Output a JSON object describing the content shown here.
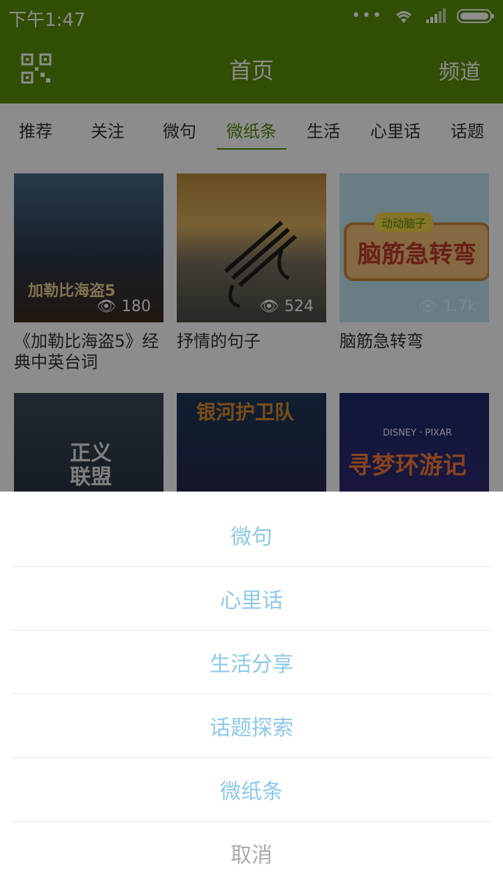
{
  "status": {
    "time": "下午1:47"
  },
  "header": {
    "title": "首页",
    "channel_label": "频道"
  },
  "tabs": [
    {
      "label": "推荐"
    },
    {
      "label": "关注"
    },
    {
      "label": "微句"
    },
    {
      "label": "微纸条",
      "active": true
    },
    {
      "label": "生活"
    },
    {
      "label": "心里话"
    },
    {
      "label": "话题"
    }
  ],
  "cards": [
    {
      "title": "《加勒比海盗5》经典中英台词",
      "views": "180",
      "poster_text": "加勒比海盗5"
    },
    {
      "title": "抒情的句子",
      "views": "524"
    },
    {
      "title": "脑筋急转弯",
      "views": "1.7k",
      "poster_text": "脑筋急转弯",
      "poster_badge": "动动脑子"
    },
    {
      "poster_text": "正义联盟"
    },
    {
      "poster_text": "银河护卫队"
    },
    {
      "poster_text": "寻梦环游记",
      "poster_badge": "DISNEY · PIXAR"
    }
  ],
  "action_sheet": {
    "items": [
      "微句",
      "心里话",
      "生活分享",
      "话题探索",
      "微纸条"
    ],
    "cancel": "取消"
  },
  "colors": {
    "brand": "#5a8f0a",
    "sheet_text": "#8cc8e8",
    "cancel_text": "#aaaaaa"
  }
}
